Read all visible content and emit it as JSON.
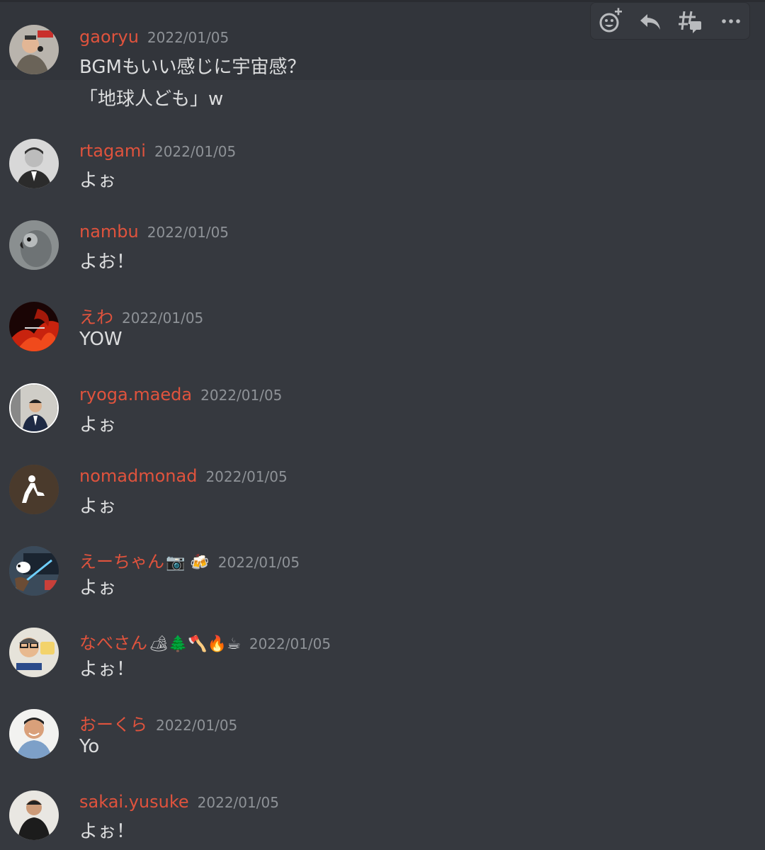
{
  "messages": [
    {
      "author": "gaoryu",
      "timestamp": "2022/01/05",
      "lines": [
        "BGMもいい感じに宇宙感？",
        "「地球人ども」w"
      ],
      "emoji": ""
    },
    {
      "author": "rtagami",
      "timestamp": "2022/01/05",
      "lines": [
        "よぉ"
      ],
      "emoji": ""
    },
    {
      "author": "nambu",
      "timestamp": "2022/01/05",
      "lines": [
        "よお！"
      ],
      "emoji": ""
    },
    {
      "author": "えわ",
      "timestamp": "2022/01/05",
      "lines": [
        "YOW"
      ],
      "emoji": ""
    },
    {
      "author": "ryoga.maeda",
      "timestamp": "2022/01/05",
      "lines": [
        "よぉ"
      ],
      "emoji": ""
    },
    {
      "author": "nomadmonad",
      "timestamp": "2022/01/05",
      "lines": [
        "よぉ"
      ],
      "emoji": ""
    },
    {
      "author": "えーちゃん",
      "timestamp": "2022/01/05",
      "lines": [
        "よぉ"
      ],
      "emoji": "📷 🍻"
    },
    {
      "author": "なべさん",
      "timestamp": "2022/01/05",
      "lines": [
        "よぉ！"
      ],
      "emoji": "🏕🌲🪓🔥☕"
    },
    {
      "author": "おーくら",
      "timestamp": "2022/01/05",
      "lines": [
        "Yo"
      ],
      "emoji": ""
    },
    {
      "author": "sakai.yusuke",
      "timestamp": "2022/01/05",
      "lines": [
        "よぉ！"
      ],
      "emoji": ""
    }
  ],
  "toolbar": {
    "icons": [
      "add-reaction-icon",
      "reply-icon",
      "create-thread-icon",
      "more-options-icon"
    ]
  },
  "colors": {
    "background": "#36393f",
    "hover_background": "#32353b",
    "author_name": "#e0533d",
    "timestamp": "#8e9297",
    "message_text": "#dcddde"
  }
}
